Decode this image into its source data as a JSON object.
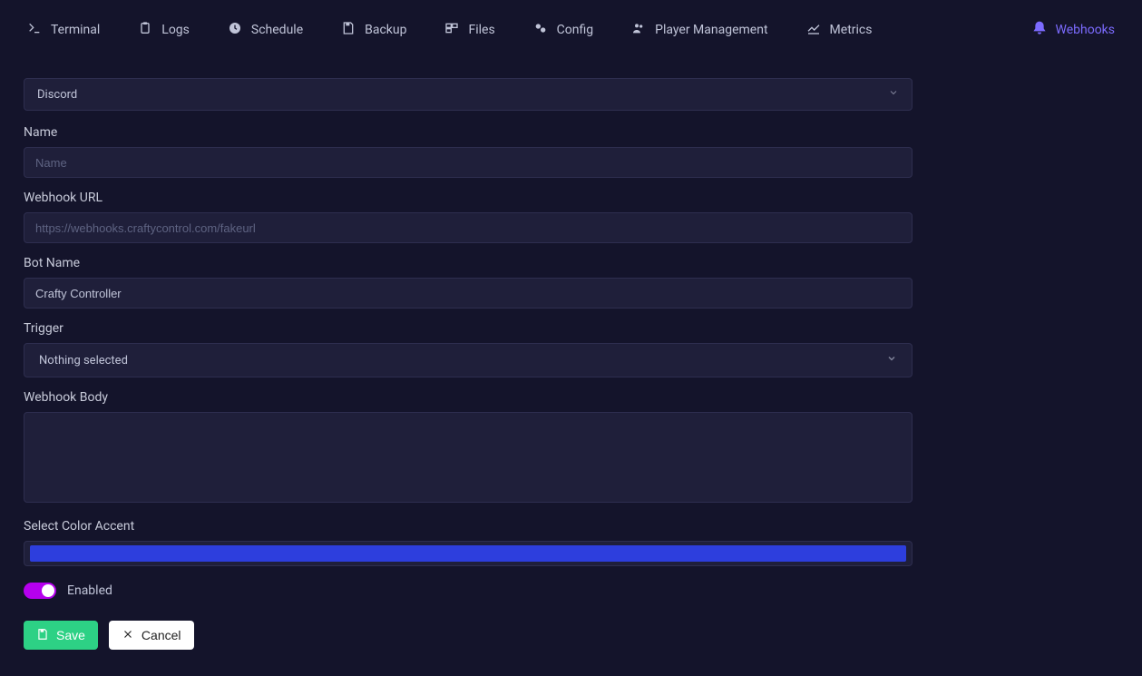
{
  "tabs": {
    "terminal": "Terminal",
    "logs": "Logs",
    "schedule": "Schedule",
    "backup": "Backup",
    "files": "Files",
    "config": "Config",
    "player_management": "Player Management",
    "metrics": "Metrics",
    "webhooks": "Webhooks"
  },
  "form": {
    "service_select": "Discord",
    "name_label": "Name",
    "name_placeholder": "Name",
    "name_value": "",
    "url_label": "Webhook URL",
    "url_placeholder": "https://webhooks.craftycontrol.com/fakeurl",
    "url_value": "",
    "botname_label": "Bot Name",
    "botname_value": "Crafty Controller",
    "trigger_label": "Trigger",
    "trigger_value": "Nothing selected",
    "body_label": "Webhook Body",
    "body_value": "",
    "color_label": "Select Color Accent",
    "color_value": "#2d3edd",
    "enabled_label": "Enabled",
    "enabled": true,
    "toggle_on_color": "#b500ee"
  },
  "buttons": {
    "save": "Save",
    "cancel": "Cancel"
  }
}
